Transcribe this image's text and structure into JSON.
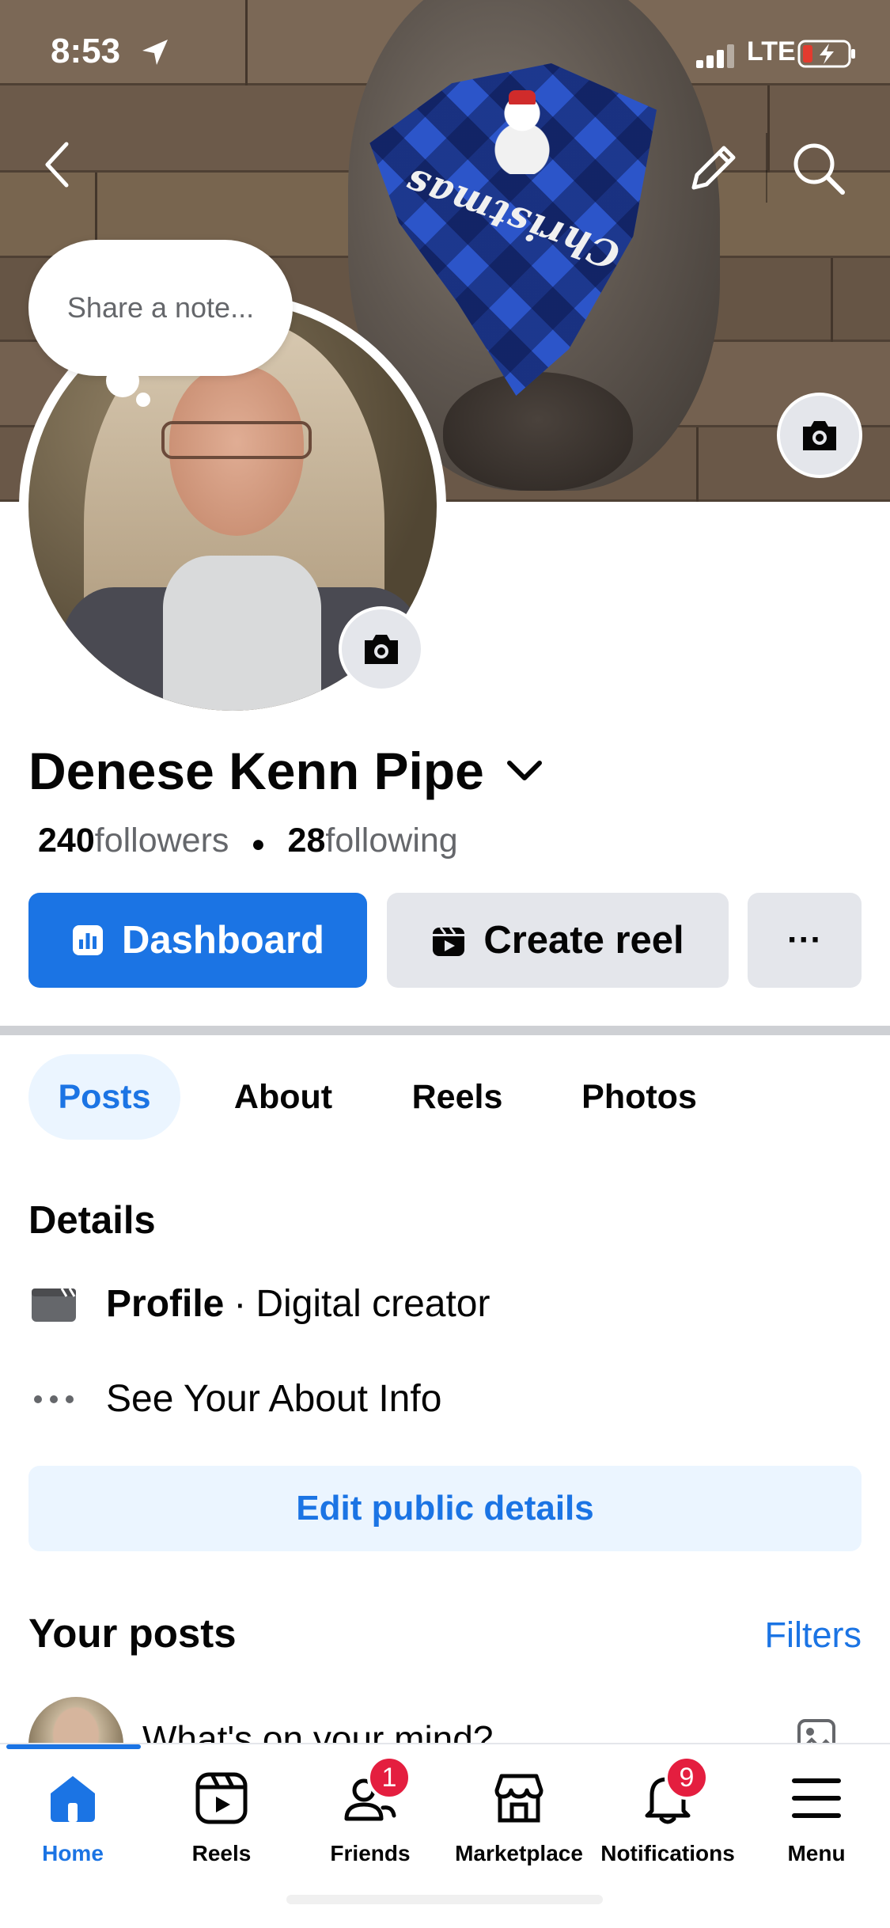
{
  "status_bar": {
    "time": "8:53",
    "network": "LTE"
  },
  "note": {
    "placeholder": "Share a note..."
  },
  "profile": {
    "name": "Denese Kenn Pipe",
    "followers_count": "240",
    "followers_label": "followers",
    "following_count": "28",
    "following_label": "following"
  },
  "actions": {
    "dashboard_label": "Dashboard",
    "create_reel_label": "Create reel",
    "more_label": "···"
  },
  "tabs": [
    {
      "label": "Posts",
      "active": true
    },
    {
      "label": "About",
      "active": false
    },
    {
      "label": "Reels",
      "active": false
    },
    {
      "label": "Photos",
      "active": false
    }
  ],
  "details": {
    "title": "Details",
    "profile_type_label": "Profile",
    "separator": "·",
    "profile_type_value": "Digital creator",
    "about_info_label": "See Your About Info",
    "edit_button_label": "Edit public details"
  },
  "posts": {
    "title": "Your posts",
    "filters_label": "Filters",
    "composer_placeholder": "What's on your mind?"
  },
  "bottom_nav": [
    {
      "label": "Home",
      "icon": "home-icon",
      "active": true,
      "badge": ""
    },
    {
      "label": "Reels",
      "icon": "reels-icon",
      "active": false,
      "badge": ""
    },
    {
      "label": "Friends",
      "icon": "friends-icon",
      "active": false,
      "badge": "1"
    },
    {
      "label": "Marketplace",
      "icon": "marketplace-icon",
      "active": false,
      "badge": ""
    },
    {
      "label": "Notifications",
      "icon": "bell-icon",
      "active": false,
      "badge": "9"
    },
    {
      "label": "Menu",
      "icon": "menu-icon",
      "active": false,
      "badge": ""
    }
  ],
  "colors": {
    "accent": "#1b74e4",
    "accent_light": "#ebf5ff",
    "button_gray": "#e4e6eb",
    "badge_red": "#e41e3f",
    "secondary_text": "#65676b"
  }
}
